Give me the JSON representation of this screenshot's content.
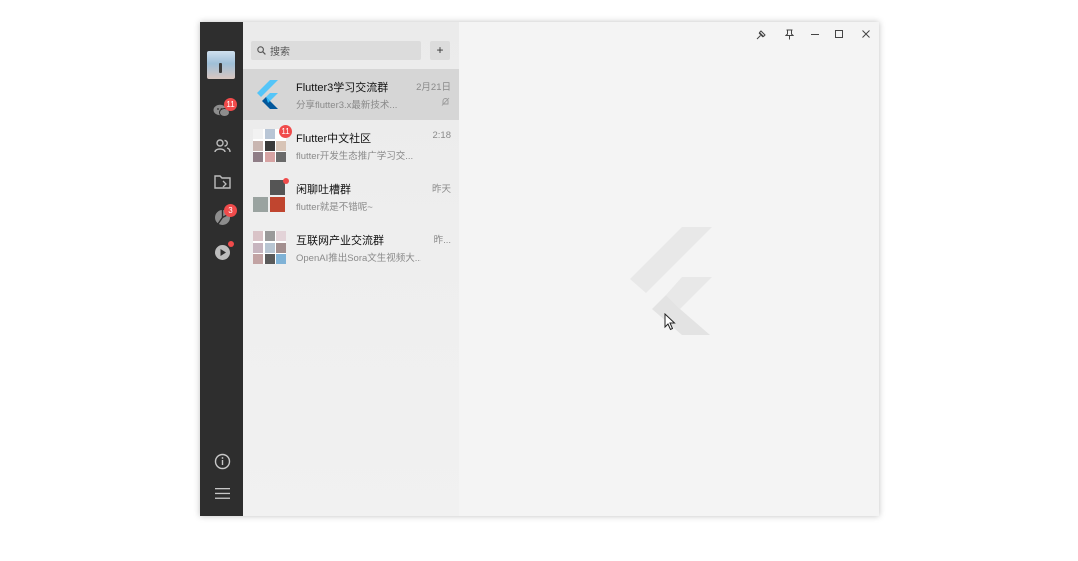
{
  "search": {
    "placeholder": "搜索",
    "add_label": "+"
  },
  "rail": {
    "chat_badge": "11",
    "moments_badge": "3"
  },
  "chats": [
    {
      "name": "Flutter3学习交流群",
      "message": "分享flutter3.x最新技术...",
      "time": "2月21日",
      "muted": true
    },
    {
      "name": "Flutter中文社区",
      "message": "flutter开发生态推广学习交...",
      "time": "2:18",
      "badge": "11"
    },
    {
      "name": "闲聊吐槽群",
      "message": "flutter就是不错呢~",
      "time": "昨天",
      "dot": true
    },
    {
      "name": "互联网产业交流群",
      "message": "OpenAI推出Sora文生视频大...",
      "time": "昨..."
    }
  ],
  "icons": {
    "chat": "chat-icon",
    "contacts": "contacts-icon",
    "folder": "folder-icon",
    "moments": "moments-icon",
    "video": "video-icon",
    "info": "info-icon",
    "menu": "menu-icon",
    "pin": "pin-icon",
    "keep_top": "keep-top-icon",
    "minimize": "minimize-icon",
    "maximize": "maximize-icon",
    "close": "close-icon"
  },
  "colors": {
    "rail": "#2e2e2e",
    "badge": "#f04b4b",
    "flutter_blue": "#54c5f8",
    "flutter_dark": "#01579b"
  }
}
